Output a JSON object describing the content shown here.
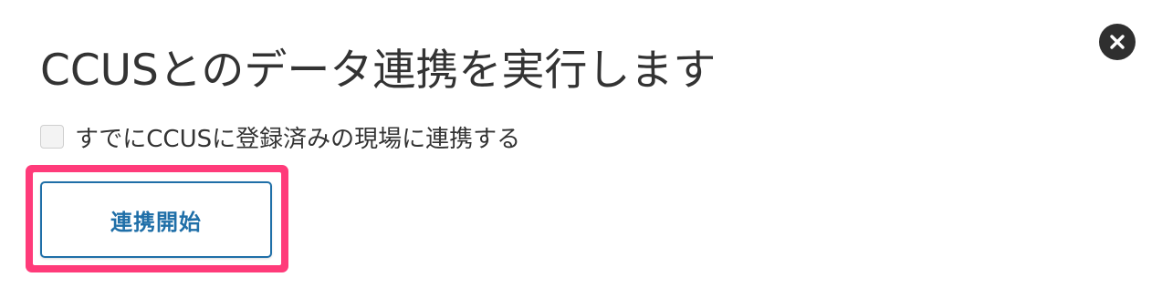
{
  "dialog": {
    "title": "CCUSとのデータ連携を実行します",
    "close_icon": "close-icon",
    "checkbox": {
      "label": "すでにCCUSに登録済みの現場に連携する",
      "checked": false
    },
    "start_button_label": "連携開始"
  },
  "colors": {
    "text": "#333333",
    "accent": "#1f6fa8",
    "highlight": "#ff3b7a",
    "close_bg": "#2f2f2f"
  }
}
